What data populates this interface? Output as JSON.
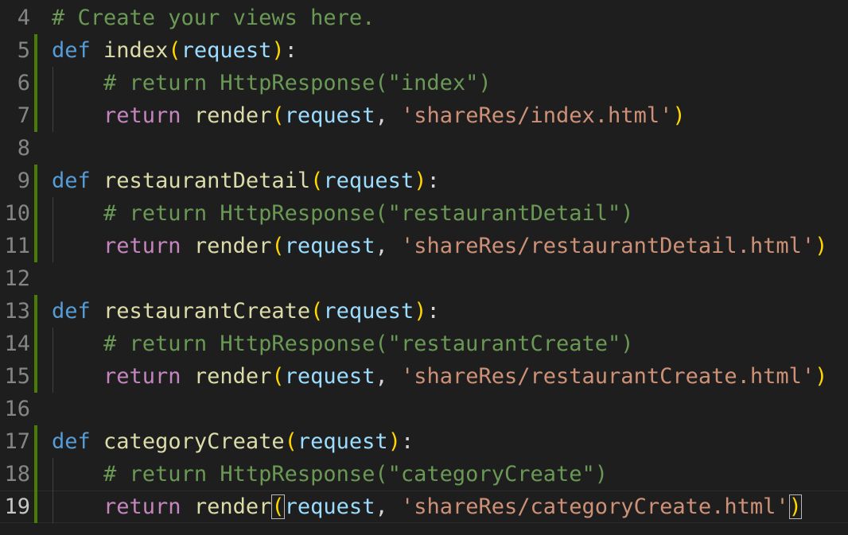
{
  "editor": {
    "current_line": "19",
    "colors": {
      "background": "#1e1e1e",
      "line_number": "#858585",
      "keyword": "#569cd6",
      "control_keyword": "#c586c0",
      "function": "#dcdcaa",
      "parameter": "#9cdcfe",
      "comment": "#6a9955",
      "string": "#ce9178",
      "bracket": "#ffd700",
      "diff_added": "#487e02"
    },
    "lines": [
      {
        "num": "4",
        "tokens": [
          {
            "cls": "cmt",
            "text": "# Create your views here."
          }
        ]
      },
      {
        "num": "5",
        "tokens": [
          {
            "cls": "kw-def",
            "text": "def"
          },
          {
            "cls": "punct",
            "text": " "
          },
          {
            "cls": "fn",
            "text": "index"
          },
          {
            "cls": "br1",
            "text": "("
          },
          {
            "cls": "param",
            "text": "request"
          },
          {
            "cls": "br1",
            "text": ")"
          },
          {
            "cls": "punct",
            "text": ":"
          }
        ]
      },
      {
        "num": "6",
        "tokens": [
          {
            "cls": "punct",
            "text": "    "
          },
          {
            "cls": "cmt",
            "text": "# return HttpResponse(\"index\")"
          }
        ]
      },
      {
        "num": "7",
        "tokens": [
          {
            "cls": "punct",
            "text": "    "
          },
          {
            "cls": "kw-flow",
            "text": "return"
          },
          {
            "cls": "punct",
            "text": " "
          },
          {
            "cls": "fn",
            "text": "render"
          },
          {
            "cls": "br1",
            "text": "("
          },
          {
            "cls": "param",
            "text": "request"
          },
          {
            "cls": "punct",
            "text": ", "
          },
          {
            "cls": "str",
            "text": "'shareRes/index.html'"
          },
          {
            "cls": "br1",
            "text": ")"
          }
        ]
      },
      {
        "num": "8",
        "tokens": []
      },
      {
        "num": "9",
        "tokens": [
          {
            "cls": "kw-def",
            "text": "def"
          },
          {
            "cls": "punct",
            "text": " "
          },
          {
            "cls": "fn",
            "text": "restaurantDetail"
          },
          {
            "cls": "br1",
            "text": "("
          },
          {
            "cls": "param",
            "text": "request"
          },
          {
            "cls": "br1",
            "text": ")"
          },
          {
            "cls": "punct",
            "text": ":"
          }
        ]
      },
      {
        "num": "10",
        "tokens": [
          {
            "cls": "punct",
            "text": "    "
          },
          {
            "cls": "cmt",
            "text": "# return HttpResponse(\"restaurantDetail\")"
          }
        ]
      },
      {
        "num": "11",
        "tokens": [
          {
            "cls": "punct",
            "text": "    "
          },
          {
            "cls": "kw-flow",
            "text": "return"
          },
          {
            "cls": "punct",
            "text": " "
          },
          {
            "cls": "fn",
            "text": "render"
          },
          {
            "cls": "br1",
            "text": "("
          },
          {
            "cls": "param",
            "text": "request"
          },
          {
            "cls": "punct",
            "text": ", "
          },
          {
            "cls": "str",
            "text": "'shareRes/restaurantDetail.html'"
          },
          {
            "cls": "br1",
            "text": ")"
          }
        ]
      },
      {
        "num": "12",
        "tokens": []
      },
      {
        "num": "13",
        "tokens": [
          {
            "cls": "kw-def",
            "text": "def"
          },
          {
            "cls": "punct",
            "text": " "
          },
          {
            "cls": "fn",
            "text": "restaurantCreate"
          },
          {
            "cls": "br1",
            "text": "("
          },
          {
            "cls": "param",
            "text": "request"
          },
          {
            "cls": "br1",
            "text": ")"
          },
          {
            "cls": "punct",
            "text": ":"
          }
        ]
      },
      {
        "num": "14",
        "tokens": [
          {
            "cls": "punct",
            "text": "    "
          },
          {
            "cls": "cmt",
            "text": "# return HttpResponse(\"restaurantCreate\")"
          }
        ]
      },
      {
        "num": "15",
        "tokens": [
          {
            "cls": "punct",
            "text": "    "
          },
          {
            "cls": "kw-flow",
            "text": "return"
          },
          {
            "cls": "punct",
            "text": " "
          },
          {
            "cls": "fn",
            "text": "render"
          },
          {
            "cls": "br1",
            "text": "("
          },
          {
            "cls": "param",
            "text": "request"
          },
          {
            "cls": "punct",
            "text": ", "
          },
          {
            "cls": "str",
            "text": "'shareRes/restaurantCreate.html'"
          },
          {
            "cls": "br1",
            "text": ")"
          }
        ]
      },
      {
        "num": "16",
        "tokens": []
      },
      {
        "num": "17",
        "tokens": [
          {
            "cls": "kw-def",
            "text": "def"
          },
          {
            "cls": "punct",
            "text": " "
          },
          {
            "cls": "fn",
            "text": "categoryCreate"
          },
          {
            "cls": "br1",
            "text": "("
          },
          {
            "cls": "param",
            "text": "request"
          },
          {
            "cls": "br1",
            "text": ")"
          },
          {
            "cls": "punct",
            "text": ":"
          }
        ]
      },
      {
        "num": "18",
        "tokens": [
          {
            "cls": "punct",
            "text": "    "
          },
          {
            "cls": "cmt",
            "text": "# return HttpResponse(\"categoryCreate\")"
          }
        ]
      },
      {
        "num": "19",
        "tokens": [
          {
            "cls": "punct",
            "text": "    "
          },
          {
            "cls": "kw-flow",
            "text": "return"
          },
          {
            "cls": "punct",
            "text": " "
          },
          {
            "cls": "fn",
            "text": "render"
          },
          {
            "cls": "br1 br-match",
            "text": "("
          },
          {
            "cls": "param",
            "text": "request"
          },
          {
            "cls": "punct",
            "text": ", "
          },
          {
            "cls": "str",
            "text": "'shareRes/categoryCreate.html'"
          },
          {
            "cls": "br1 br-match",
            "text": ")"
          }
        ]
      }
    ]
  }
}
